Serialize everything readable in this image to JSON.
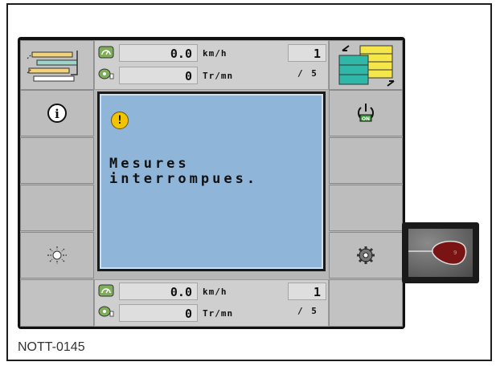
{
  "top_status": {
    "speed_value": "0.0",
    "speed_unit": "km/h",
    "rpm_value": "0",
    "rpm_unit": "Tr/mn",
    "page_current": "1",
    "page_total": "/ 5"
  },
  "bottom_status": {
    "speed_value": "0.0",
    "speed_unit": "km/h",
    "rpm_value": "0",
    "rpm_unit": "Tr/mn",
    "page_current": "1",
    "page_total": "/ 5"
  },
  "dialog": {
    "icon": "warning-icon",
    "icon_glyph": "!",
    "message": "Mesures\ninterrompues."
  },
  "softkeys_left": [
    "info-icon",
    "",
    "",
    "light-icon",
    ""
  ],
  "softkeys_right": [
    "power-on-icon",
    "",
    "",
    "settings-icon",
    ""
  ],
  "colors": {
    "dialog_bg": "#8fb5d9",
    "warning": "#f2c400",
    "on_badge": "#3e9a3e",
    "knob_red": "#7a1414"
  },
  "figure_ref": "NOTT-0145"
}
